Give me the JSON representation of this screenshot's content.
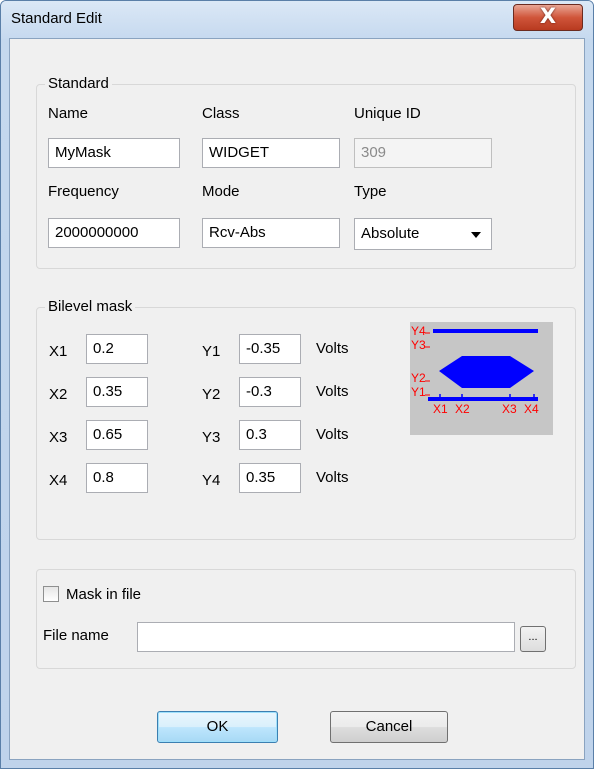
{
  "window": {
    "title": "Standard Edit",
    "close_glyph": "X"
  },
  "standard": {
    "group_title": "Standard",
    "name_label": "Name",
    "name_value": "MyMask",
    "class_label": "Class",
    "class_value": "WIDGET",
    "uid_label": "Unique ID",
    "uid_value": "309",
    "freq_label": "Frequency",
    "freq_value": "2000000000",
    "mode_label": "Mode",
    "mode_value": "Rcv-Abs",
    "type_label": "Type",
    "type_value": "Absolute"
  },
  "bilevel": {
    "group_title": "Bilevel mask",
    "x": [
      {
        "label": "X1",
        "value": "0.2"
      },
      {
        "label": "X2",
        "value": "0.35"
      },
      {
        "label": "X3",
        "value": "0.65"
      },
      {
        "label": "X4",
        "value": "0.8"
      }
    ],
    "y": [
      {
        "label": "Y1",
        "value": "-0.35"
      },
      {
        "label": "Y2",
        "value": "-0.3"
      },
      {
        "label": "Y3",
        "value": "0.3"
      },
      {
        "label": "Y4",
        "value": "0.35"
      }
    ],
    "unit": "Volts",
    "preview": {
      "y_labels": [
        "Y4",
        "Y3",
        "Y2",
        "Y1"
      ],
      "x_labels": [
        "X1",
        "X2",
        "X3",
        "X4"
      ],
      "label_color": "#ff0000",
      "mask_color": "#0000ff",
      "background": "#c6c6c6"
    }
  },
  "file": {
    "checkbox_label": "Mask in file",
    "checked": false,
    "filename_label": "File name",
    "filename_value": "",
    "browse_label": "..."
  },
  "buttons": {
    "ok": "OK",
    "cancel": "Cancel"
  }
}
